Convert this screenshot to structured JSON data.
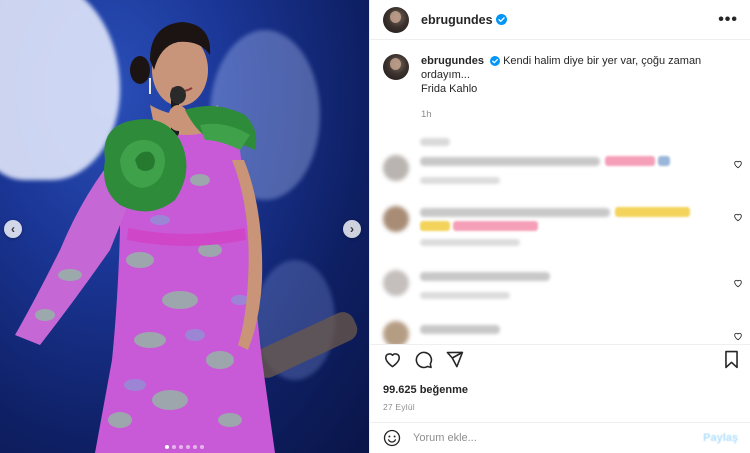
{
  "post": {
    "username": "ebrugundes",
    "caption_text": "Kendi halim diye bir yer var, çoğu zaman ordayım...",
    "caption_signature": "Frida Kahlo",
    "time_ago": "1h",
    "likes": "99.625 beğenme",
    "date": "27 Eylül"
  },
  "comment_box": {
    "placeholder": "Yorum ekle...",
    "post_label": "Paylaş"
  },
  "header": {
    "more_label": "•••"
  },
  "carousel": {
    "slide_count": 6,
    "active_index": 0,
    "prev_glyph": "‹",
    "next_glyph": "›"
  },
  "colors": {
    "verified_blue": "#0095f6",
    "dress_purple": "#c85ad8",
    "rose_green": "#2e8b3a",
    "stage_blue": "#1a3594"
  },
  "icons": [
    "verified-icon",
    "more-icon",
    "heart-icon",
    "comment-icon",
    "share-icon",
    "save-icon",
    "emoji-icon",
    "chevron-left-icon",
    "chevron-right-icon"
  ]
}
